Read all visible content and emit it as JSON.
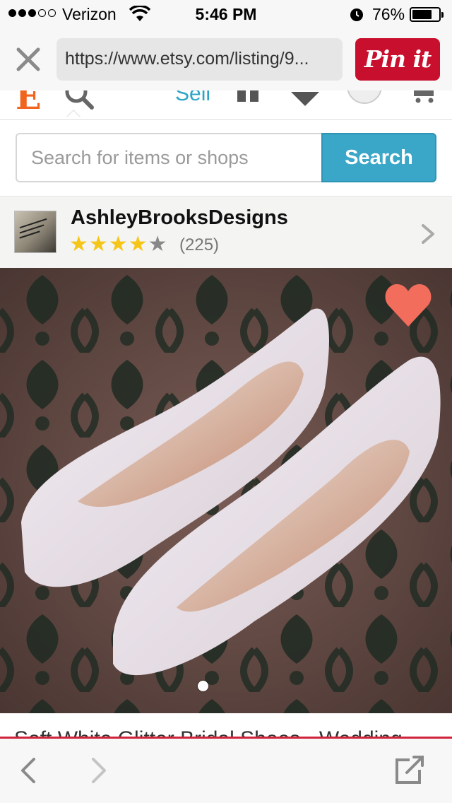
{
  "status_bar": {
    "carrier": "Verizon",
    "time": "5:46 PM",
    "battery_percent": "76%",
    "battery_level": 0.76,
    "signal_bars": 3,
    "signal_total": 5
  },
  "browser": {
    "url": "https://www.etsy.com/listing/9...",
    "pinit_label": "Pin it",
    "close_icon": "close-icon"
  },
  "site_nav": {
    "logo_letter": "E",
    "sell_label": "Sell",
    "icons": [
      "search-icon",
      "gift-icon",
      "heart-icon",
      "avatar-icon",
      "cart-icon"
    ]
  },
  "search": {
    "placeholder": "Search for items or shops",
    "button_label": "Search"
  },
  "shop": {
    "name": "AshleyBrooksDesigns",
    "rating_stars": 4,
    "rating_max": 5,
    "reviews": "(225)"
  },
  "listing": {
    "title": "Soft White Glitter Bridal Shoes - Wedding",
    "image_count_visible": 1
  },
  "colors": {
    "etsy_orange": "#f1641e",
    "search_blue": "#3aa6c8",
    "pinit_red": "#c8102e",
    "heart_coral": "#f26d5b",
    "star_gold": "#f5c518"
  },
  "toolbar": {
    "icons": [
      "back-icon",
      "forward-icon",
      "share-icon"
    ]
  }
}
